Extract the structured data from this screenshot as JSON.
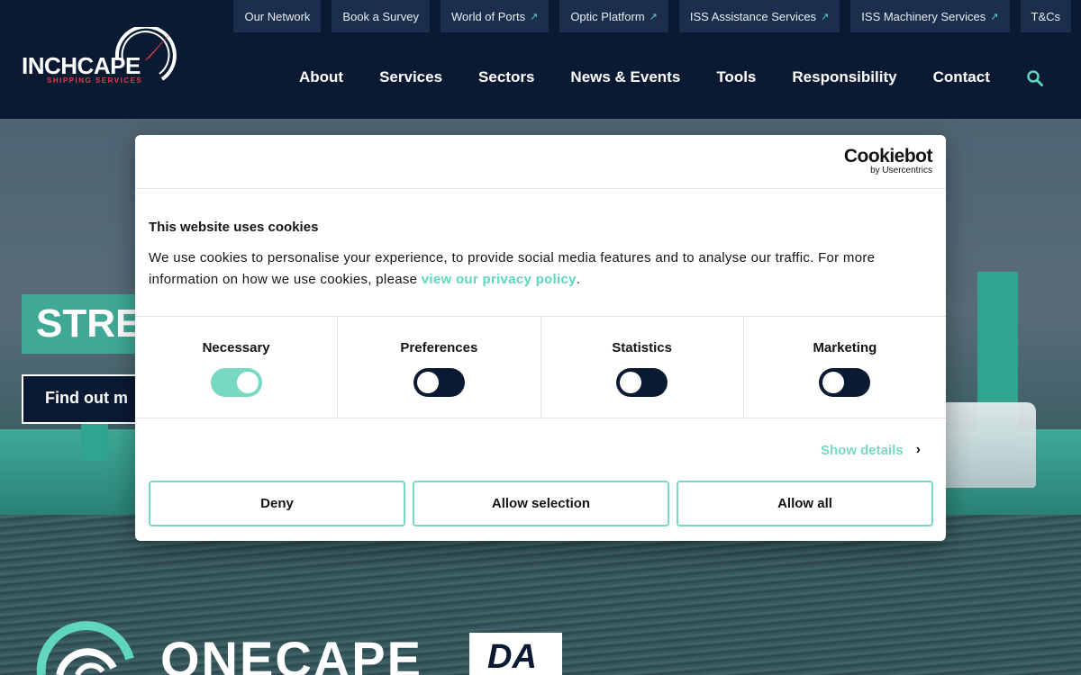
{
  "brand": {
    "logo_word": "INCHCAPE",
    "logo_sub": "SHIPPING SERVICES",
    "accent": "#5fd6bd",
    "navy": "#0b1a33",
    "logo_red": "#e23b4a"
  },
  "utility_nav": [
    {
      "label": "Our Network",
      "external": false
    },
    {
      "label": "Book a Survey",
      "external": false
    },
    {
      "label": "World of Ports",
      "external": true
    },
    {
      "label": "Optic Platform",
      "external": true
    },
    {
      "label": "ISS Assistance Services",
      "external": true
    },
    {
      "label": "ISS Machinery Services",
      "external": true
    },
    {
      "label": "T&Cs",
      "external": false
    }
  ],
  "main_nav": [
    "About",
    "Services",
    "Sectors",
    "News & Events",
    "Tools",
    "Responsibility",
    "Contact"
  ],
  "search_icon": "search-icon",
  "hero": {
    "tag_text": "STRE",
    "button_label": "Find out m",
    "onecape_word": "ONECAPE",
    "da_label": "DA"
  },
  "cookie_dialog": {
    "brand_name": "Cookiebot",
    "brand_by": "by Usercentrics",
    "title": "This website uses cookies",
    "text_before_link": "We use cookies to personalise your experience, to provide social media features and to analyse our traffic. For more information on how we use cookies, please ",
    "link_text": "view our privacy policy",
    "text_after_link": ".",
    "toggles": [
      {
        "label": "Necessary",
        "on": true
      },
      {
        "label": "Preferences",
        "on": false
      },
      {
        "label": "Statistics",
        "on": false
      },
      {
        "label": "Marketing",
        "on": false
      }
    ],
    "show_details": "Show details",
    "buttons": {
      "deny": "Deny",
      "allow_selection": "Allow selection",
      "allow_all": "Allow all"
    }
  }
}
